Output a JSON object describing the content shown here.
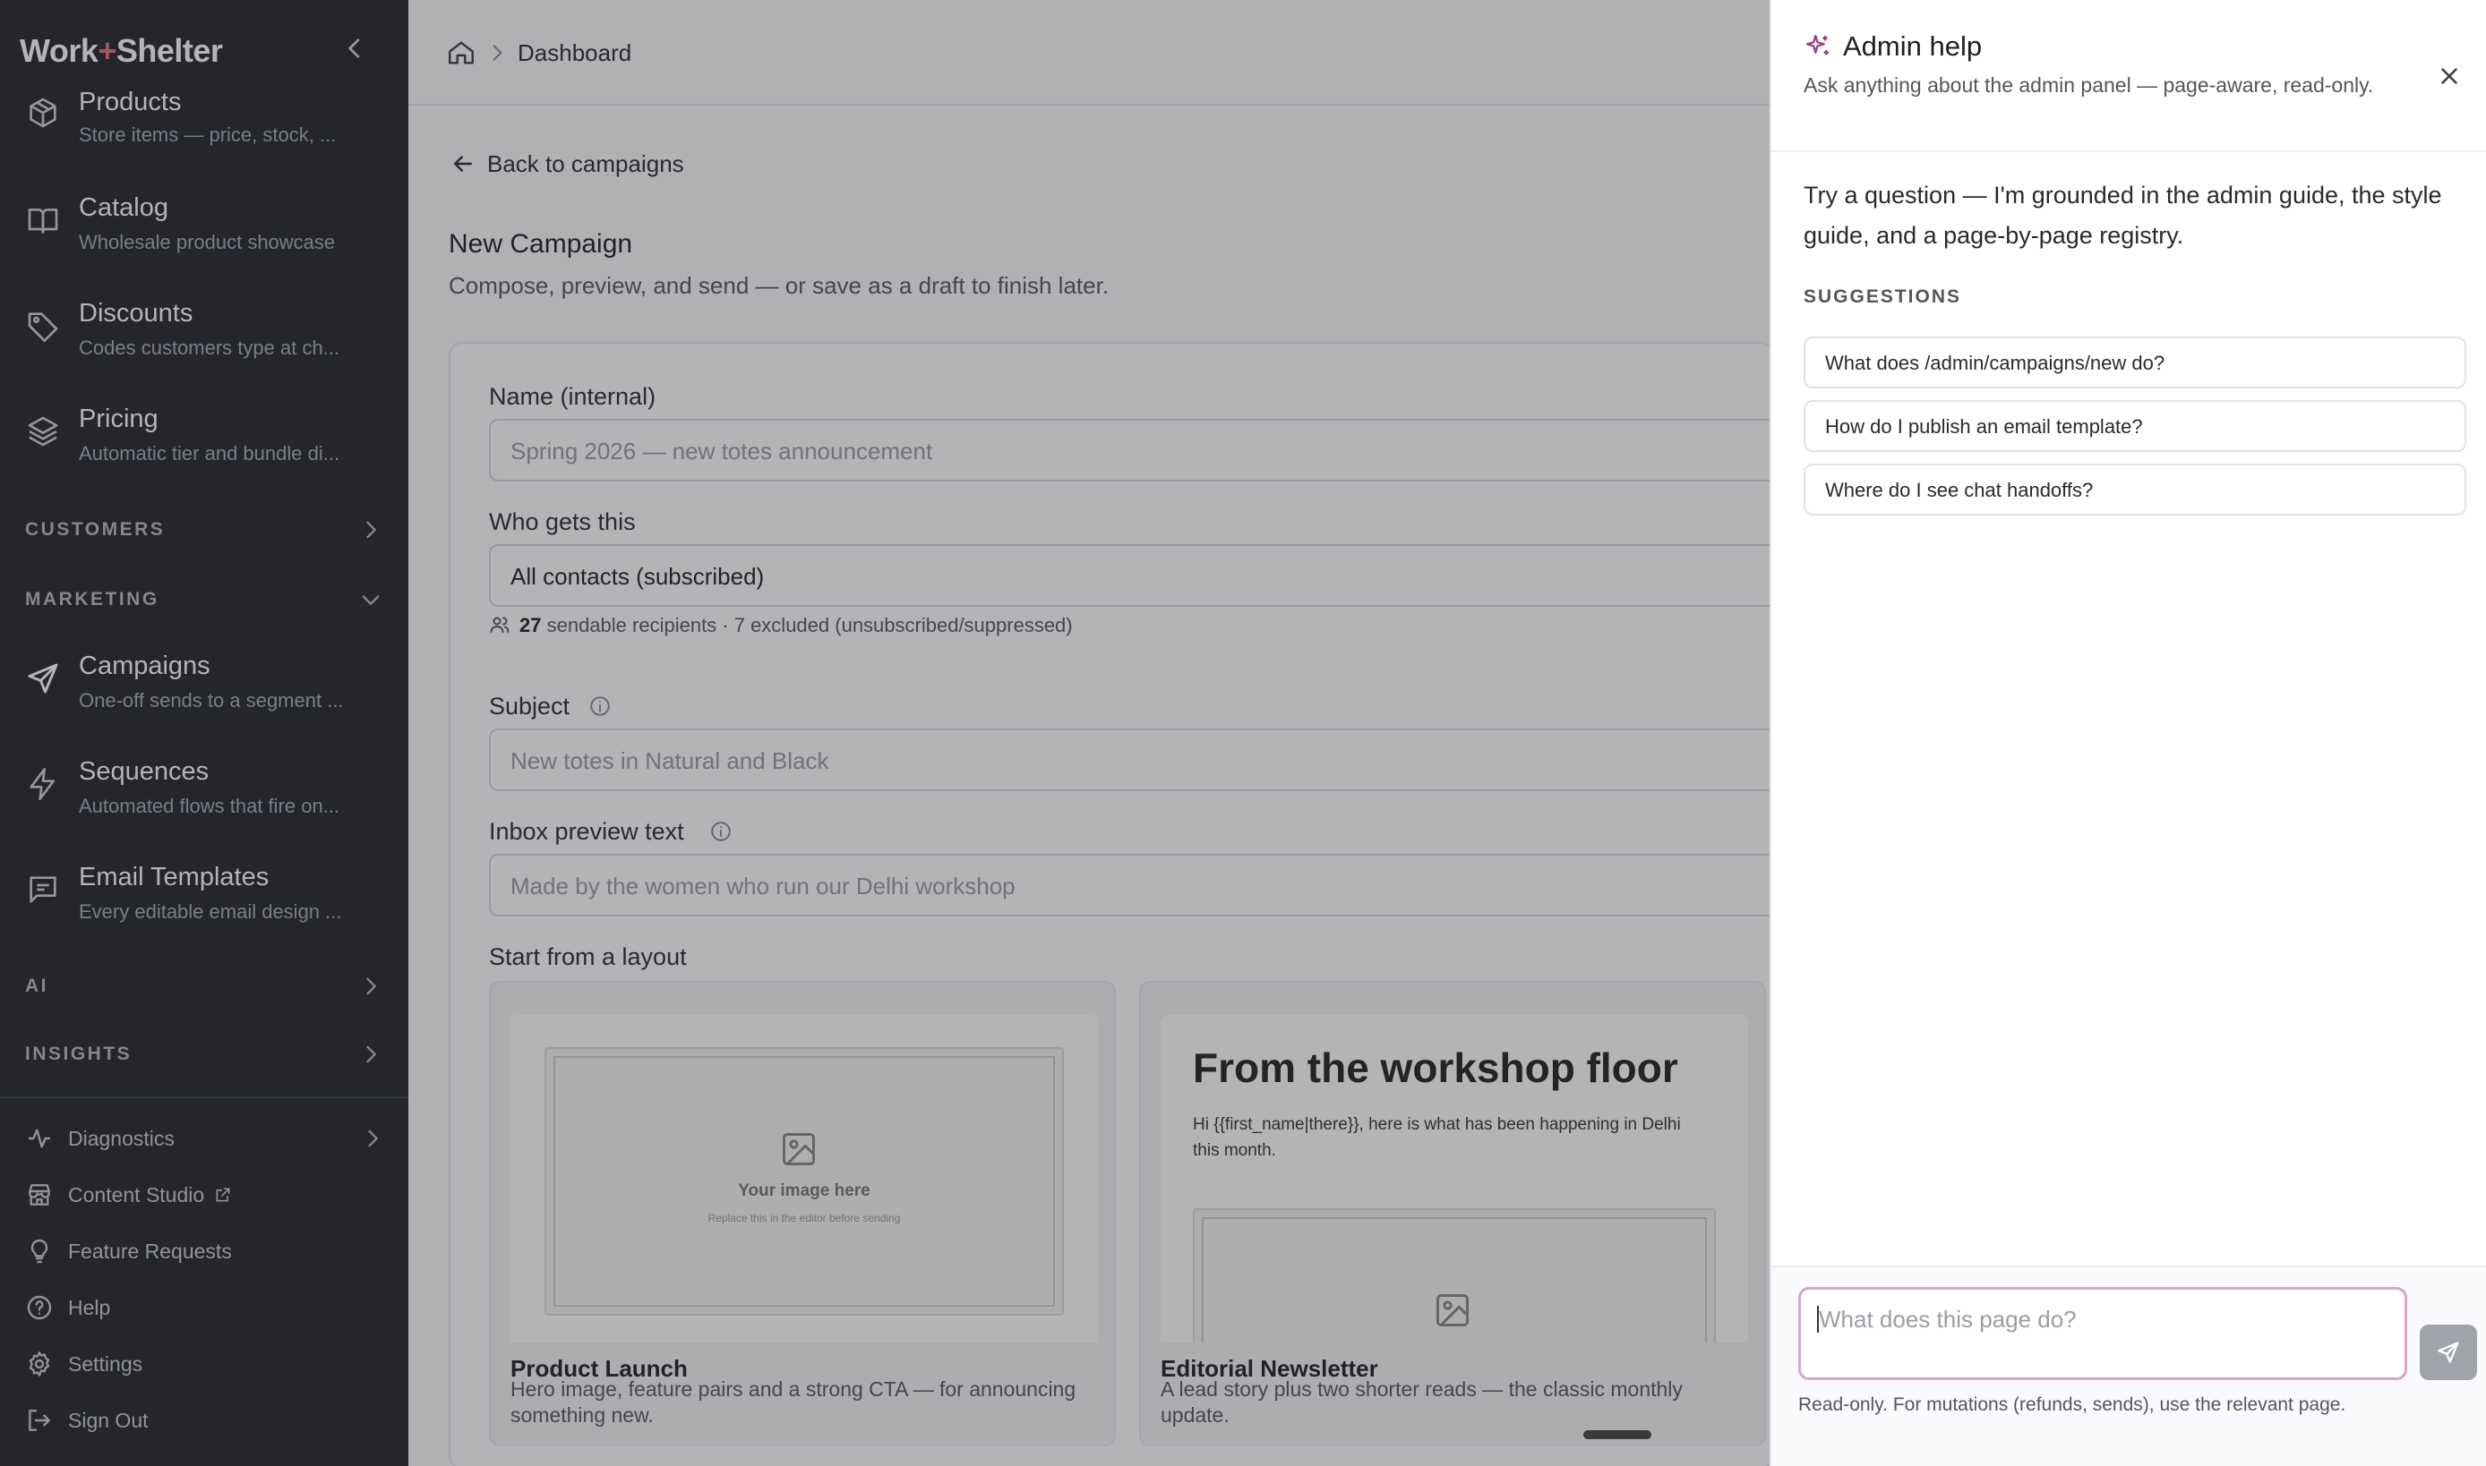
{
  "brand": {
    "part1": "Work",
    "plus": "+",
    "part2": "Shelter"
  },
  "sidebar": {
    "nav": [
      {
        "title": "Products",
        "desc": "Store items — price, stock, ..."
      },
      {
        "title": "Catalog",
        "desc": "Wholesale product showcase"
      },
      {
        "title": "Discounts",
        "desc": "Codes customers type at ch..."
      },
      {
        "title": "Pricing",
        "desc": "Automatic tier and bundle di..."
      },
      {
        "title": "Campaigns",
        "desc": "One-off sends to a segment ..."
      },
      {
        "title": "Sequences",
        "desc": "Automated flows that fire on..."
      },
      {
        "title": "Email Templates",
        "desc": "Every editable email design ..."
      }
    ],
    "sections": {
      "customers": "CUSTOMERS",
      "marketing": "MARKETING",
      "ai": "AI",
      "insights": "INSIGHTS"
    },
    "footer": {
      "diagnostics": "Diagnostics",
      "content_studio": "Content Studio",
      "feature_requests": "Feature Requests",
      "help": "Help",
      "settings": "Settings",
      "sign_out": "Sign Out"
    }
  },
  "header": {
    "breadcrumb": "Dashboard"
  },
  "main": {
    "back": "Back to campaigns",
    "title": "New Campaign",
    "subtitle": "Compose, preview, and send — or save as a draft to finish later.",
    "name_label": "Name (internal)",
    "name_placeholder": "Spring 2026 — new totes announcement",
    "audience_label": "Who gets this",
    "audience_value": "All contacts (subscribed)",
    "recipients_count": "27",
    "recipients_text": "sendable recipients · 7 excluded (unsubscribed/suppressed)",
    "subject_label": "Subject",
    "subject_placeholder": "New totes in Natural and Black",
    "preview_label": "Inbox preview text",
    "preview_placeholder": "Made by the women who run our Delhi workshop",
    "layout_label": "Start from a layout",
    "layouts": [
      {
        "name": "Product Launch",
        "desc": "Hero image, feature pairs and a strong CTA — for announcing something new.",
        "img_title": "Your image here",
        "img_sub": "Replace this in the editor before sending"
      },
      {
        "name": "Editorial Newsletter",
        "desc": "A lead story plus two shorter reads — the classic monthly update.",
        "heading": "From the workshop floor",
        "body": "Hi {{first_name|there}}, here is what has been happening in Delhi this month."
      }
    ]
  },
  "help_panel": {
    "title": "Admin help",
    "subtitle": "Ask anything about the admin panel — page-aware, read-only.",
    "intro": "Try a question — I'm grounded in the admin guide, the style guide, and a page-by-page registry.",
    "suggestions_heading": "SUGGESTIONS",
    "suggestions": [
      "What does /admin/campaigns/new do?",
      "How do I publish an email template?",
      "Where do I see chat handoffs?"
    ],
    "input_placeholder": "What does this page do?",
    "note": "Read-only. For mutations (refunds, sends), use the relevant page."
  },
  "colors": {
    "sidebar_bg": "#22252a",
    "accent": "#9c3c7c",
    "brand_plus": "#e0707a"
  }
}
